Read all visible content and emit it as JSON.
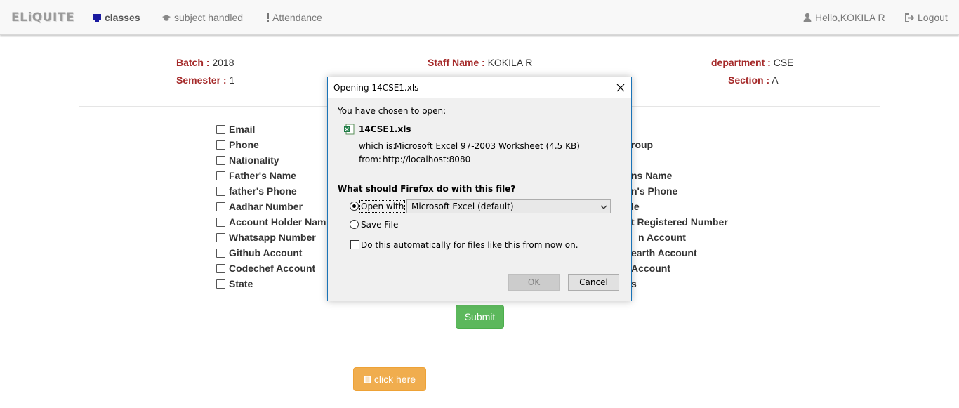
{
  "navbar": {
    "brand": "ELiQUITE",
    "items": [
      {
        "label": "classes"
      },
      {
        "label": "subject handled"
      },
      {
        "label": "Attendance"
      }
    ],
    "user_greeting": "Hello,KOKILA R",
    "logout_label": "Logout"
  },
  "info": {
    "batch_label": "Batch :",
    "batch_value": "2018",
    "semester_label": "Semester :",
    "semester_value": "1",
    "staff_label": "Staff Name :",
    "staff_value": "KOKILA R",
    "department_label": "department :",
    "department_value": "CSE",
    "section_label": "Section :",
    "section_value": "A"
  },
  "fields_left": [
    "Email",
    "Phone",
    "Nationality",
    "Father's Name",
    "father's Phone",
    "Aadhar Number",
    "Account Holder Nam",
    "Whatsapp Number",
    "Github Account",
    "Codechef Account",
    "State"
  ],
  "fields_right": [
    "roup",
    "ns Name",
    "n's Phone",
    "le",
    "t Registered Number",
    "n Account",
    "earth Account",
    "Account",
    "s"
  ],
  "submit_label": "Submit",
  "click_here_label": "click here",
  "dialog": {
    "title": "Opening 14CSE1.xls",
    "chosen_text": "You have chosen to open:",
    "filename": "14CSE1.xls",
    "which_is_label": "which is:",
    "which_is_value": "Microsoft Excel 97-2003 Worksheet (4.5 KB)",
    "from_label": "from:",
    "from_value": "http://localhost:8080",
    "question": "What should Firefox do with this file?",
    "open_with_label": "Open with",
    "open_with_selected": "Microsoft Excel (default)",
    "save_file_label": "Save File",
    "auto_label": "Do this automatically for files like this from now on.",
    "ok_label": "OK",
    "cancel_label": "Cancel"
  },
  "colors": {
    "label_red": "#a52a2a",
    "success": "#5cb85c",
    "warning": "#f0ad4e",
    "dialog_border": "#1a73b7"
  }
}
